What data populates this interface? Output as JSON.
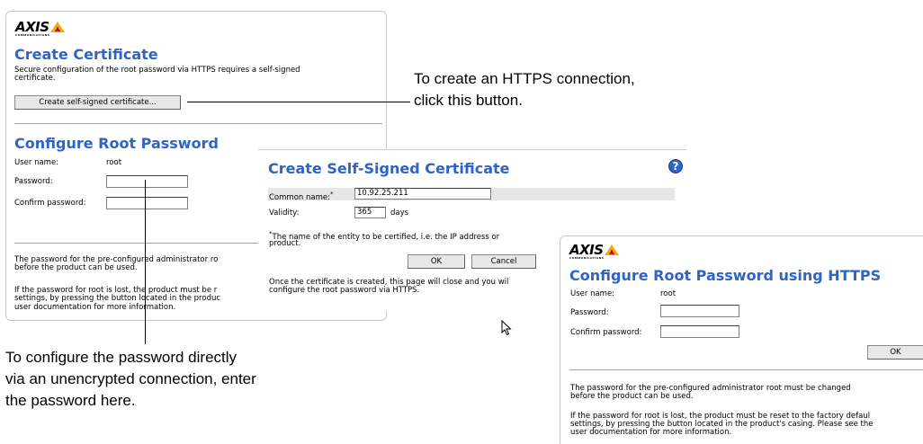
{
  "window1": {
    "logo_text": "AXIS",
    "logo_sub": "COMMUNICATIONS",
    "title": "Create Certificate",
    "desc_line1": "Secure configuration of the root password via HTTPS requires a self-signed",
    "desc_line2": "certificate.",
    "create_button": "Create self-signed certificate...",
    "section_title": "Configure Root Password",
    "user_label": "User name:",
    "user_value": "root",
    "password_label": "Password:",
    "confirm_label": "Confirm password:",
    "note1_line1": "The password for the pre-configured administrator ro",
    "note1_line2": "before the product can be used.",
    "note2_line1": "If the password for root is lost, the product must be r",
    "note2_line2": "settings, by pressing the button located in the produc",
    "note2_line3": "user documentation for more information."
  },
  "window2": {
    "title": "Create Self-Signed Certificate",
    "common_name_label": "Common name:",
    "required_mark": "*",
    "common_name_value": "10.92.25.211",
    "validity_label": "Validity:",
    "validity_value": "365",
    "validity_unit": "days",
    "footnote_line1": "The name of the entity to be certified, i.e. the IP address or",
    "footnote_line2": "product.",
    "ok_button": "OK",
    "cancel_button": "Cancel",
    "info_line1": "Once the certificate is created, this page will close and you wil",
    "info_line2": "configure the root password via HTTPS."
  },
  "window3": {
    "logo_text": "AXIS",
    "logo_sub": "COMMUNICATIONS",
    "title": "Configure Root Password using HTTPS",
    "user_label": "User name:",
    "user_value": "root",
    "password_label": "Password:",
    "confirm_label": "Confirm password:",
    "ok_button": "OK",
    "note1_line1": "The password for the pre-configured administrator root must be changed",
    "note1_line2": "before the product can be used.",
    "note2_line1": "If the password for root is lost, the product must be reset to the factory defaul",
    "note2_line2": "settings, by pressing the button located in the product's casing. Please see the",
    "note2_line3": "user documentation for more information."
  },
  "callouts": {
    "https_line1": "To create an HTTPS connection,",
    "https_line2": "click this button.",
    "direct_line1": "To configure the password directly",
    "direct_line2": "via an unencrypted connection, enter",
    "direct_line3": "the password here."
  }
}
